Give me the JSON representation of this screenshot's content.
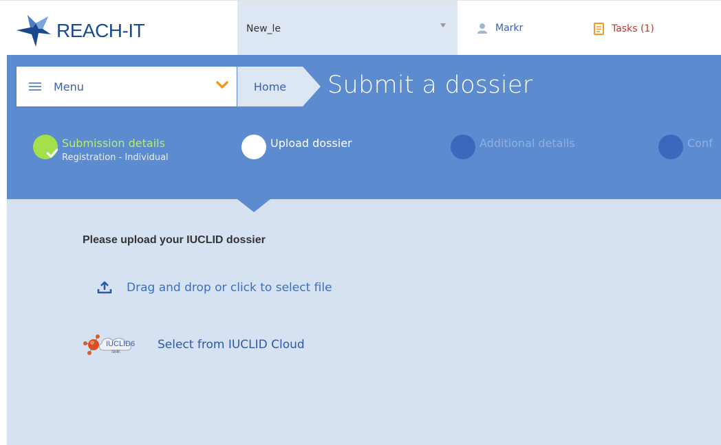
{
  "header": {
    "logo_text": "REACH-IT",
    "legal_entity": "New_le",
    "user_name": "Markr",
    "tasks_label": "Tasks (1)"
  },
  "nav": {
    "menu_label": "Menu",
    "breadcrumb_home": "Home",
    "page_title": "Submit a dossier"
  },
  "steps": [
    {
      "title": "Submission details",
      "subtitle": "Registration - Individual",
      "state": "completed"
    },
    {
      "title": "Upload dossier",
      "subtitle": "",
      "state": "current"
    },
    {
      "title": "Additional details",
      "subtitle": "",
      "state": "pending"
    },
    {
      "title": "Conf",
      "subtitle": "",
      "state": "pending"
    }
  ],
  "upload": {
    "heading": "Please upload your IUCLID dossier",
    "drag_drop_label": "Drag and drop or click to select file",
    "cloud_label": "Select from IUCLID Cloud",
    "cloud_logo_text": "IUCLID6",
    "cloud_logo_sub": "SME"
  },
  "icons": {
    "logo": "reach-it-logo",
    "user": "user-icon",
    "tasks": "tasks-icon",
    "menu": "hamburger-icon",
    "chevron": "chevron-down-icon",
    "check": "check-icon",
    "upload": "upload-icon",
    "cloud": "iuclid-cloud-icon"
  },
  "colors": {
    "brand_blue": "#5c8bd0",
    "light_panel": "#d6e1f1",
    "completed_green": "#a3e04b",
    "tasks_red": "#c23226",
    "link_blue": "#3a6fc4",
    "chevron_orange": "#f29a1e"
  }
}
